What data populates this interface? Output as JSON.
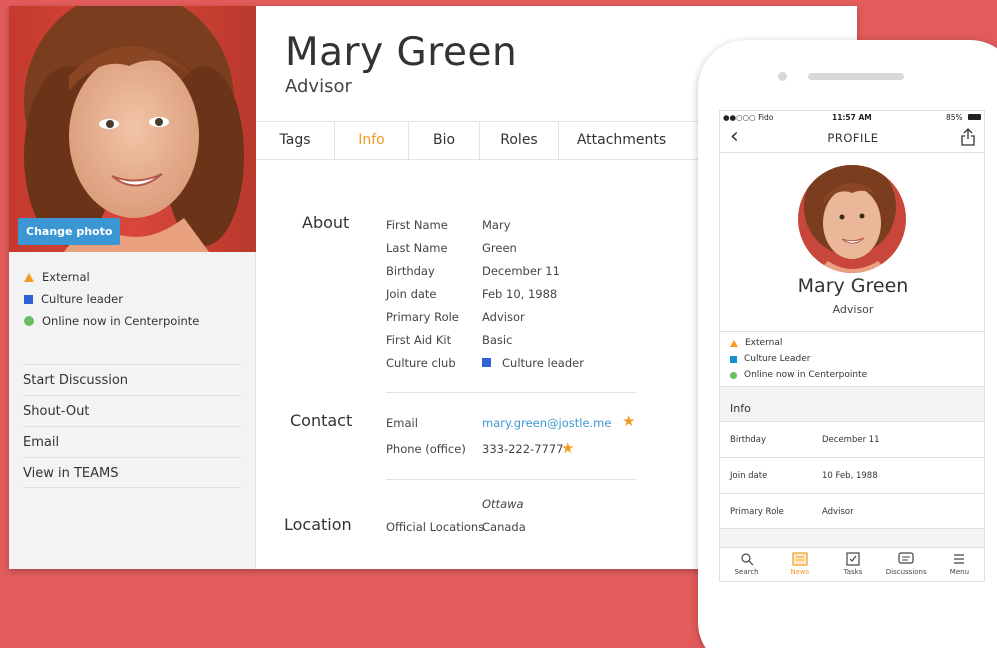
{
  "profile": {
    "name": "Mary Green",
    "role": "Advisor",
    "change_photo_label": "Change photo"
  },
  "badges": [
    {
      "label": "External",
      "icon": "triangle-icon",
      "color": "#f39c23"
    },
    {
      "label": "Culture leader",
      "icon": "square-icon",
      "color": "#2e63d8"
    },
    {
      "label": "Online now in Centerpointe",
      "icon": "dot-icon",
      "color": "#6bbd63"
    }
  ],
  "actions": [
    "Start Discussion",
    "Shout-Out",
    "Email",
    "View in TEAMS"
  ],
  "tabs": [
    "Tags",
    "Info",
    "Bio",
    "Roles",
    "Attachments"
  ],
  "active_tab": "Info",
  "about": {
    "title": "About",
    "fields": [
      {
        "label": "First Name",
        "value": "Mary"
      },
      {
        "label": "Last Name",
        "value": "Green"
      },
      {
        "label": "Birthday",
        "value": "December 11"
      },
      {
        "label": "Join date",
        "value": "Feb 10, 1988"
      },
      {
        "label": "Primary Role",
        "value": "Advisor"
      },
      {
        "label": "First Aid Kit",
        "value": "Basic"
      },
      {
        "label": "Culture club",
        "value": "Culture leader"
      }
    ]
  },
  "contact": {
    "title": "Contact",
    "email_label": "Email",
    "email_value": "mary.green@jostle.me",
    "phone_label": "Phone (office)",
    "phone_value": "333-222-7777"
  },
  "location": {
    "title": "Location",
    "label": "Official Locations",
    "city": "Ottawa",
    "country": "Canada"
  },
  "mobile": {
    "status": {
      "carrier": "●●○○○ Fido",
      "time": "11:57 AM",
      "battery": "85%"
    },
    "title": "PROFILE",
    "name": "Mary Green",
    "role": "Advisor",
    "badges": [
      "External",
      "Culture Leader",
      "Online now in Centerpointe"
    ],
    "info_heading": "Info",
    "info_rows": [
      {
        "label": "Birthday",
        "value": "December 11"
      },
      {
        "label": "Join date",
        "value": "10 Feb, 1988"
      },
      {
        "label": "Primary Role",
        "value": "Advisor"
      }
    ],
    "tabbar": [
      {
        "label": "Search",
        "icon": "search-icon"
      },
      {
        "label": "News",
        "icon": "news-icon"
      },
      {
        "label": "Tasks",
        "icon": "tasks-icon"
      },
      {
        "label": "Discussions",
        "icon": "discussions-icon"
      },
      {
        "label": "Menu",
        "icon": "menu-icon"
      }
    ],
    "active_tab": "News"
  },
  "colors": {
    "background": "#e25c5c",
    "accent": "#f39c23",
    "link": "#3b97d3",
    "culture_blue": "#2e63d8",
    "online_green": "#6bbd63"
  }
}
